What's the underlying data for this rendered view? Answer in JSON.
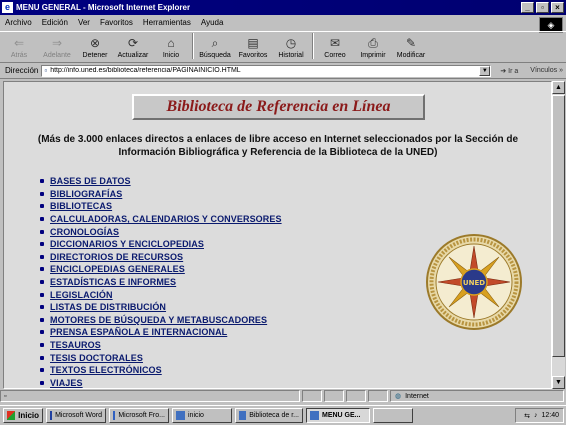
{
  "window": {
    "title": "MENU GENERAL - Microsoft Internet Explorer",
    "buttons": [
      "_",
      "▫",
      "×"
    ]
  },
  "menu": [
    "Archivo",
    "Edición",
    "Ver",
    "Favoritos",
    "Herramientas",
    "Ayuda"
  ],
  "toolbar": {
    "back": "Atrás",
    "forward": "Adelante",
    "stop": "Detener",
    "refresh": "Actualizar",
    "home": "Inicio",
    "search": "Búsqueda",
    "favorites": "Favoritos",
    "history": "Historial",
    "mail": "Correo",
    "print": "Imprimir",
    "edit": "Modificar"
  },
  "address": {
    "label": "Dirección",
    "value": "http://info.uned.es/biblioteca/referencia/PAGINAINICIO.HTML",
    "go": "Ir a",
    "links": "Vínculos"
  },
  "page": {
    "banner": "Biblioteca de Referencia en Línea",
    "description": "(Más de 3.000 enlaces directos a enlaces de libre acceso en Internet seleccionados por la Sección de Información Bibliográfica y Referencia de la Biblioteca de la UNED)",
    "links": [
      "BASES DE DATOS",
      "BIBLIOGRAFÍAS",
      "BIBLIOTECAS",
      "CALCULADORAS, CALENDARIOS Y CONVERSORES",
      "CRONOLOGÍAS",
      "DICCIONARIOS Y ENCICLOPEDIAS",
      "DIRECTORIOS DE RECURSOS",
      "ENCICLOPEDIAS GENERALES",
      "ESTADÍSTICAS E INFORMES",
      "LEGISLACIÓN",
      "LISTAS DE DISTRIBUCIÓN",
      "MOTORES DE BÚSQUEDA Y METABUSCADORES",
      "PRENSA ESPAÑOLA E INTERNACIONAL",
      "TESAUROS",
      "TESIS DOCTORALES",
      "TEXTOS ELECTRÓNICOS",
      "VIAJES"
    ],
    "seal_text": "UNED"
  },
  "status": {
    "zone": "Internet"
  },
  "taskbar": {
    "start": "Inicio",
    "items": [
      "Microsoft Word",
      "Microsoft Fro...",
      "inicio",
      "Biblioteca de r...",
      "MENU GE...",
      ""
    ],
    "clock": "12:40"
  },
  "colors": {
    "title_bar": "#000080",
    "banner_text": "#8b1a1a",
    "link": "#0a1a6e"
  }
}
